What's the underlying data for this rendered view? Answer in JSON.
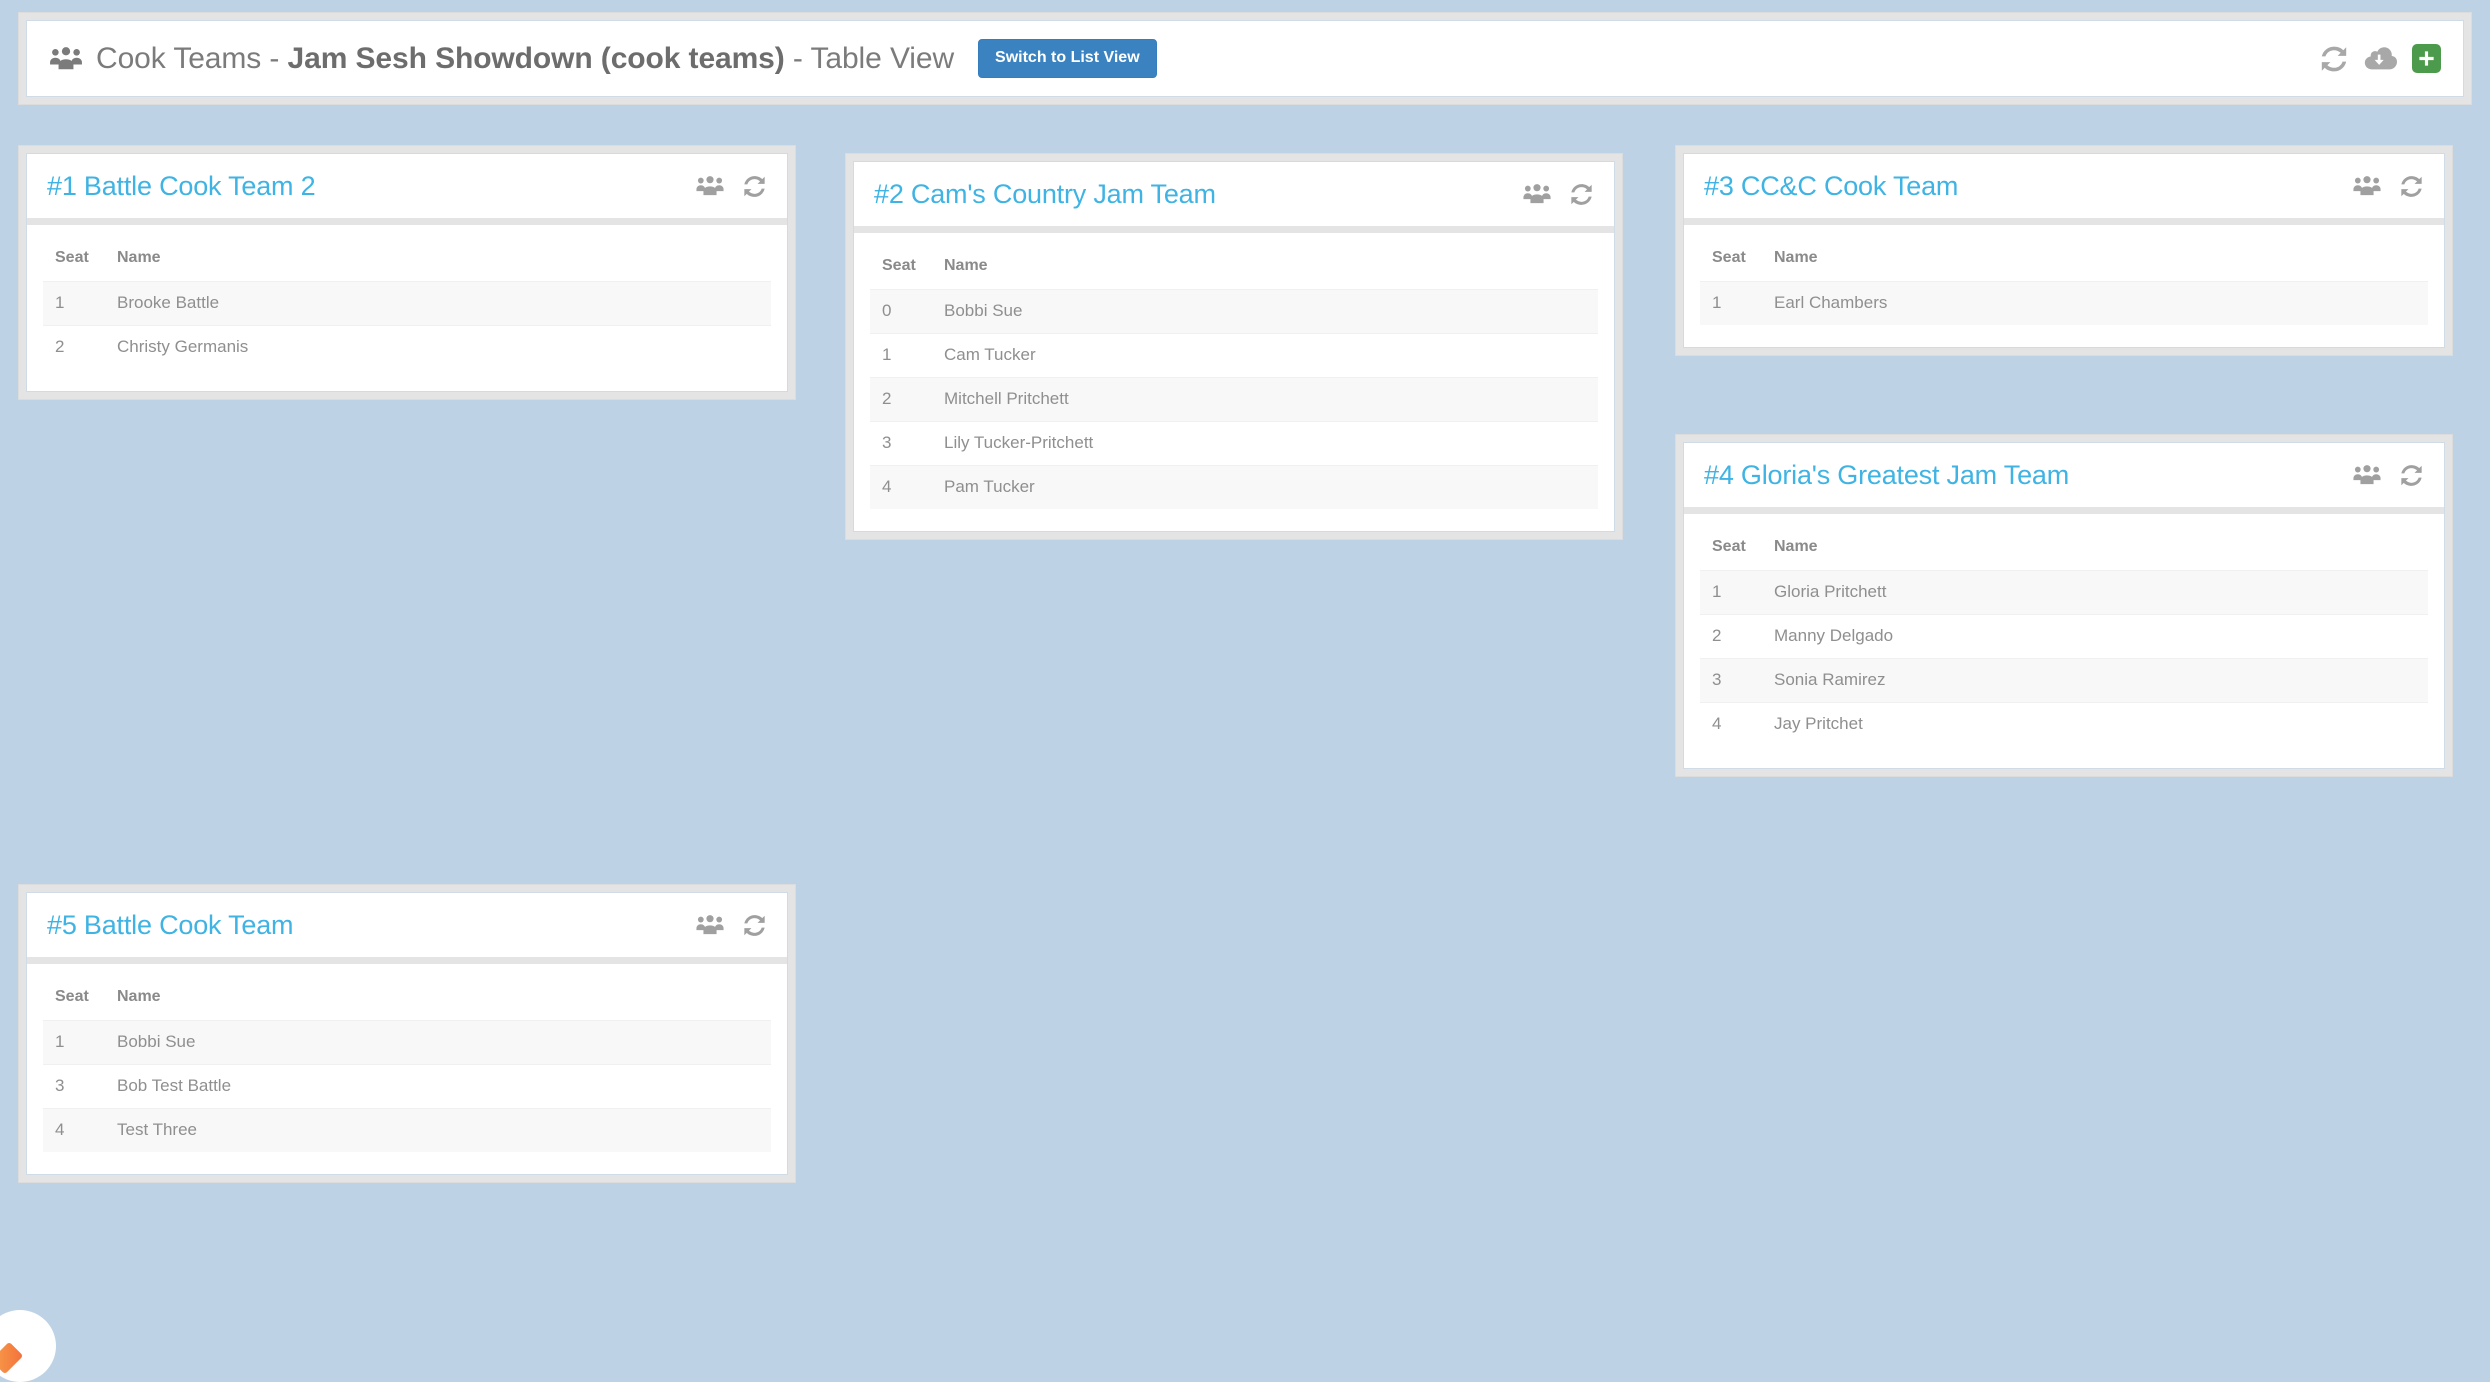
{
  "header": {
    "icon": "users-group-icon",
    "title_prefix": "Cook Teams - ",
    "title_strong": "Jam Sesh Showdown (cook teams)",
    "title_suffix": " - Table View",
    "switch_button_label": "Switch to List View",
    "actions": [
      {
        "name": "sync-icon",
        "label": "Refresh"
      },
      {
        "name": "cloud-download-icon",
        "label": "Download"
      },
      {
        "name": "plus-icon",
        "label": "Add",
        "color": "#4c9a4c"
      }
    ]
  },
  "accent_colors": {
    "card_title": "#3fb3e3",
    "primary_button": "#3b83c0",
    "add_button": "#4c9a4c",
    "page_background": "#bdd2e4",
    "panel_frame": "#e4e4e4"
  },
  "table_headers": {
    "seat": "Seat",
    "name": "Name"
  },
  "card_actions": [
    {
      "name": "members-icon"
    },
    {
      "name": "sync-icon"
    }
  ],
  "cards": [
    {
      "title": "#1 Battle Cook Team 2",
      "rows": [
        {
          "seat": "1",
          "name": "Brooke Battle"
        },
        {
          "seat": "2",
          "name": "Christy Germanis"
        }
      ]
    },
    {
      "title": "#2 Cam's Country Jam Team",
      "rows": [
        {
          "seat": "0",
          "name": "Bobbi Sue"
        },
        {
          "seat": "1",
          "name": "Cam Tucker"
        },
        {
          "seat": "2",
          "name": "Mitchell Pritchett"
        },
        {
          "seat": "3",
          "name": "Lily Tucker-Pritchett"
        },
        {
          "seat": "4",
          "name": "Pam Tucker"
        }
      ]
    },
    {
      "title": "#3 CC&C Cook Team",
      "rows": [
        {
          "seat": "1",
          "name": "Earl Chambers"
        }
      ]
    },
    {
      "title": "#4 Gloria's Greatest Jam Team",
      "rows": [
        {
          "seat": "1",
          "name": "Gloria Pritchett"
        },
        {
          "seat": "2",
          "name": "Manny Delgado"
        },
        {
          "seat": "3",
          "name": "Sonia Ramirez"
        },
        {
          "seat": "4",
          "name": "Jay Pritchet"
        }
      ]
    },
    {
      "title": "#5 Battle Cook Team",
      "rows": [
        {
          "seat": "1",
          "name": "Bobbi Sue"
        },
        {
          "seat": "3",
          "name": "Bob Test Battle"
        },
        {
          "seat": "4",
          "name": "Test Three"
        }
      ]
    }
  ]
}
